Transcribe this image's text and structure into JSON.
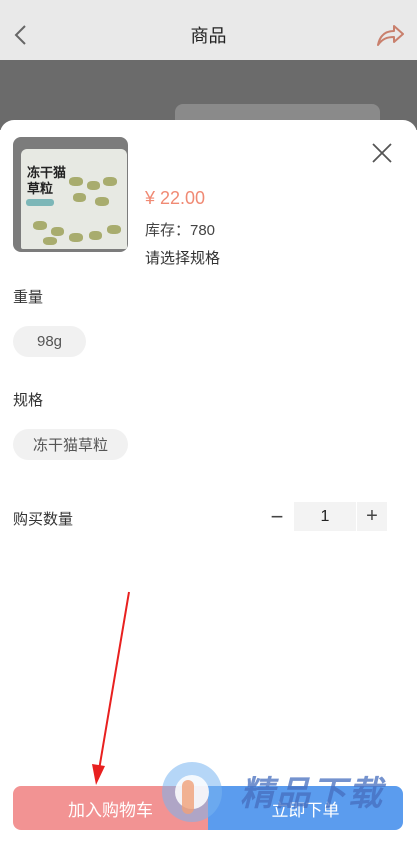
{
  "header": {
    "title": "商品"
  },
  "product": {
    "price": "¥ 22.00",
    "stock": "库存：780",
    "spec_prompt": "请选择规格",
    "package_text": "冻干猫草粒"
  },
  "options": {
    "weight_label": "重量",
    "weight_value": "98g",
    "spec_label": "规格",
    "spec_value": "冻干猫草粒"
  },
  "quantity": {
    "label": "购买数量",
    "minus": "−",
    "value": "1",
    "plus": "+"
  },
  "actions": {
    "add_to_cart": "加入购物车",
    "buy_now": "立即下单"
  },
  "watermark_text": "精品下载",
  "colors": {
    "price": "#f08a74",
    "cart_button": "#f29393",
    "buy_button": "#5b9cee",
    "annotation_arrow": "#e8201f"
  },
  "icons": {
    "back": "back-chevron-icon",
    "share": "share-arrow-icon",
    "close": "close-x-icon"
  }
}
